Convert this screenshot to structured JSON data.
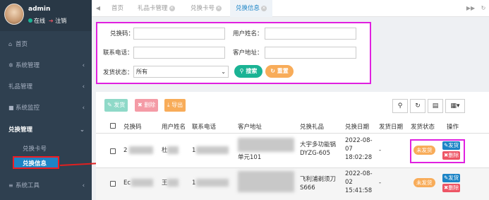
{
  "user": {
    "name": "admin",
    "status": "在线",
    "logout": "注销"
  },
  "sidebar": {
    "items": [
      {
        "label": "首页",
        "icon": "home-icon"
      },
      {
        "label": "系统管理",
        "icon": "gear-icon"
      },
      {
        "label": "礼品管理",
        "icon": ""
      },
      {
        "label": "系统监控",
        "icon": "video-icon"
      },
      {
        "label": "兑换管理",
        "icon": ""
      },
      {
        "label": "系统工具",
        "icon": "bars-icon"
      }
    ],
    "sub_items": [
      {
        "label": "兑换卡号"
      },
      {
        "label": "兑换信息"
      }
    ]
  },
  "tabs": [
    {
      "label": "首页"
    },
    {
      "label": "礼品卡管理"
    },
    {
      "label": "兑换卡号"
    },
    {
      "label": "兑换信息"
    }
  ],
  "search": {
    "code_label": "兑换码：",
    "name_label": "用户姓名：",
    "phone_label": "联系电话：",
    "address_label": "客户地址：",
    "status_label": "发货状态：",
    "status_value": "所有",
    "search_btn": "搜索",
    "reset_btn": "重置"
  },
  "toolbar": {
    "ship": "发货",
    "delete": "删除",
    "export": "导出"
  },
  "table": {
    "headers": [
      "兑换码",
      "用户姓名",
      "联系电话",
      "客户地址",
      "兑换礼品",
      "兑换日期",
      "发货日期",
      "发货状态",
      "操作"
    ],
    "rows": [
      {
        "code": "2",
        "name": "杜",
        "phone": "1",
        "address_line1": "",
        "address_line2": "单元101",
        "gift_line1": "大宇多功能锅",
        "gift_line2": "DYZG-605",
        "date_line1": "2022-08-",
        "date_line2": "07",
        "date_line3": "18:02:28",
        "ship_date": "-",
        "status": "未发货",
        "op_ship": "发货",
        "op_delete": "删除"
      },
      {
        "code": "Ec",
        "name": "王",
        "phone": "1",
        "address_line1": "",
        "address_line2": "",
        "gift_line1": "飞利浦剃须刀",
        "gift_line2": "S666",
        "date_line1": "2022-08-",
        "date_line2": "02",
        "date_line3": "15:41:58",
        "ship_date": "-",
        "status": "未发货",
        "op_ship": "发货",
        "op_delete": "删除"
      }
    ]
  },
  "colors": {
    "sidebar": "#2f4050",
    "primary": "#1c84c6",
    "green": "#1ab394",
    "orange": "#f8ac59",
    "red": "#ed5565",
    "highlight": "#e020e0"
  }
}
